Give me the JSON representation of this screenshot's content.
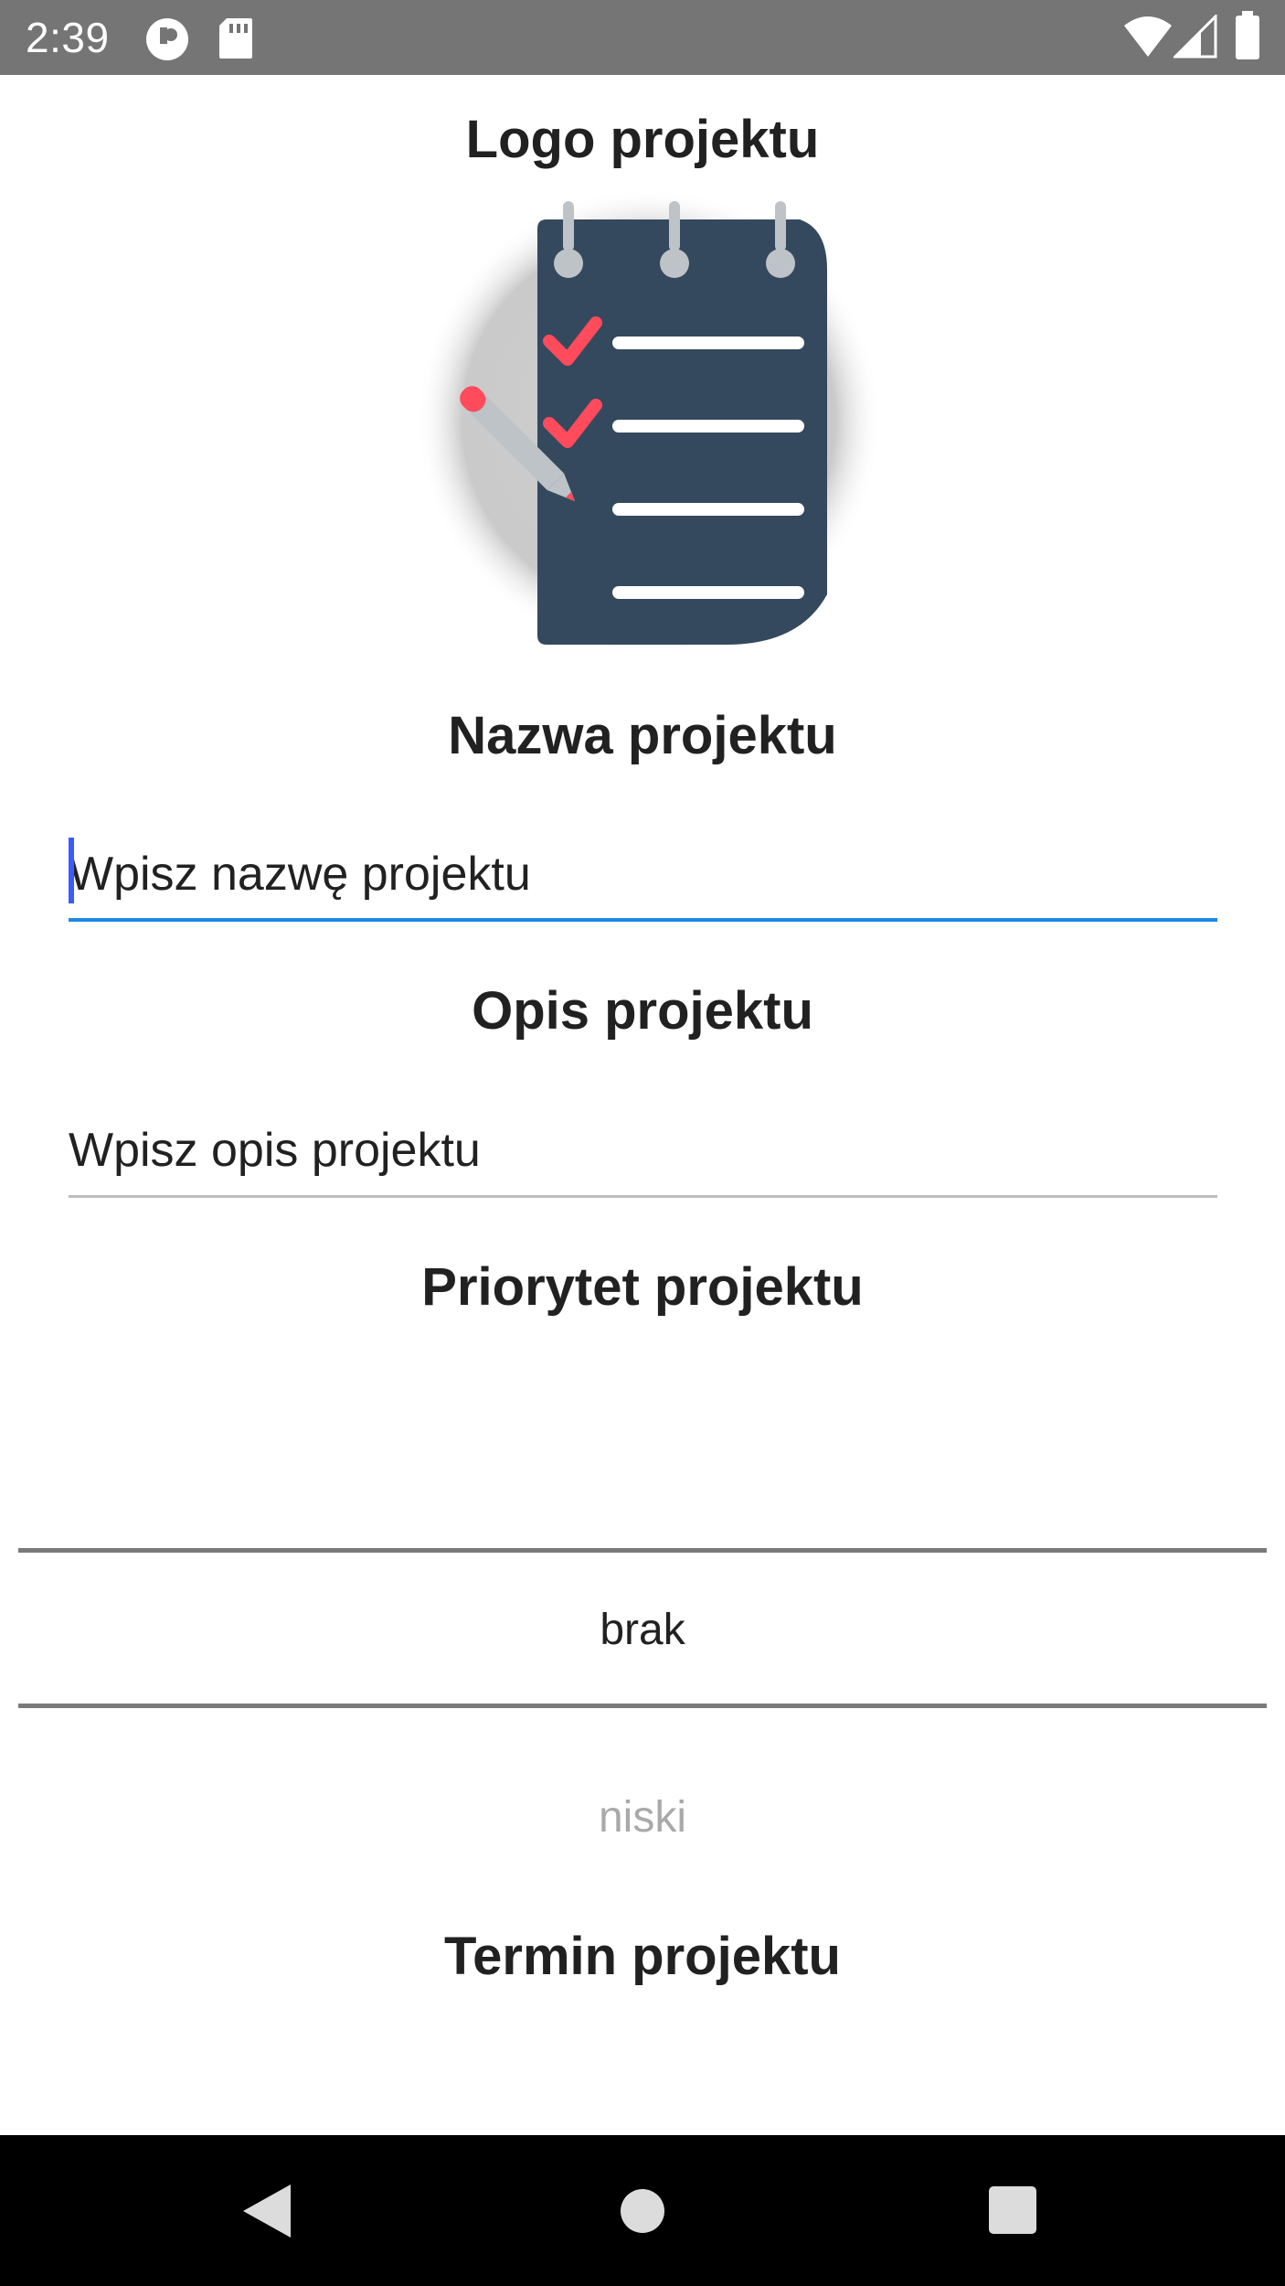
{
  "status_bar": {
    "time": "2:39",
    "icons": [
      "app-notification-icon",
      "sd-card-icon",
      "wifi-icon",
      "cell-signal-icon",
      "battery-icon"
    ],
    "background": "#757575"
  },
  "logo": {
    "heading": "Logo projektu",
    "image_icon": "notepad-checklist-icon",
    "colors": {
      "notepad": "#34495e",
      "check": "#ff4b5c",
      "lines": "#ffffff",
      "rings": "#bdc3c7",
      "backdrop": "#cccccc"
    }
  },
  "name": {
    "heading": "Nazwa projektu",
    "placeholder": "Wpisz nazwę projektu",
    "value": "",
    "focused": true
  },
  "description": {
    "heading": "Opis projektu",
    "placeholder": "Wpisz opis projektu",
    "value": ""
  },
  "priority": {
    "heading": "Priorytet projektu",
    "selected": "brak",
    "next": "niski"
  },
  "deadline": {
    "heading": "Termin projektu"
  },
  "nav_bar": {
    "buttons": [
      "back-icon",
      "home-icon",
      "recents-icon"
    ]
  },
  "colors": {
    "accent_underline": "#1e88e5",
    "caret": "#3d5afe",
    "divider": "#7a7a7a"
  }
}
